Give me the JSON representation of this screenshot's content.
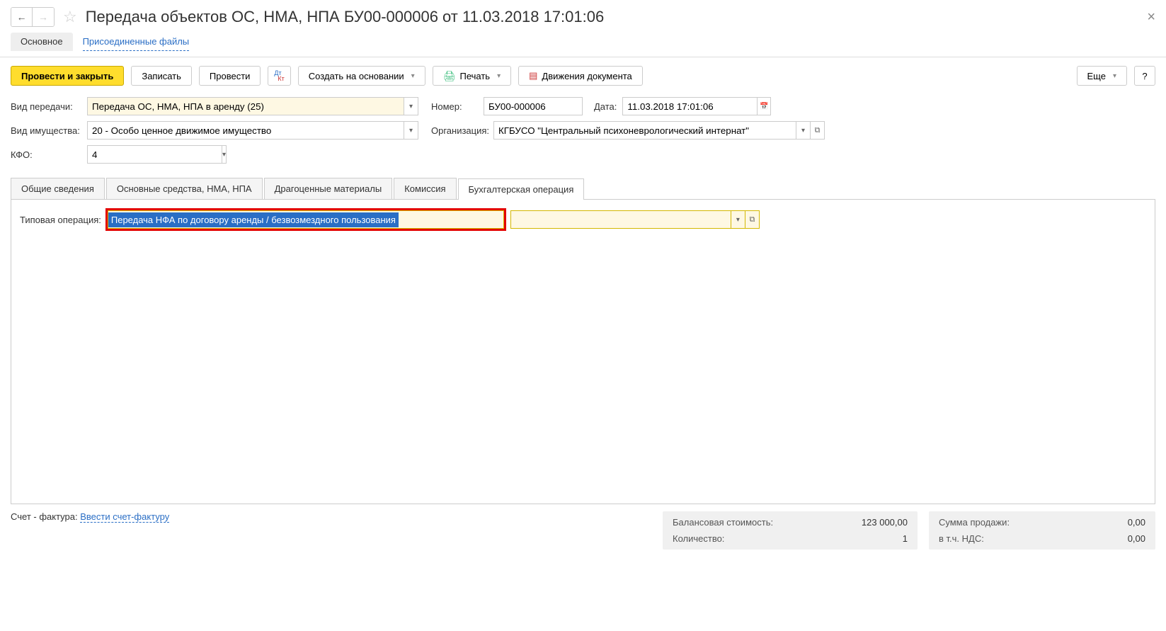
{
  "header": {
    "title": "Передача объектов ОС, НМА, НПА БУ00-000006 от 11.03.2018 17:01:06"
  },
  "subnav": {
    "main": "Основное",
    "attached": "Присоединенные файлы"
  },
  "toolbar": {
    "post_close": "Провести и закрыть",
    "save": "Записать",
    "post": "Провести",
    "create_based": "Создать на основании",
    "print": "Печать",
    "movements": "Движения документа",
    "more": "Еще",
    "help": "?"
  },
  "form": {
    "transfer_type": {
      "label": "Вид передачи:",
      "value": "Передача ОС, НМА, НПА в аренду (25)"
    },
    "number": {
      "label": "Номер:",
      "value": "БУ00-000006"
    },
    "date": {
      "label": "Дата:",
      "value": "11.03.2018 17:01:06"
    },
    "property_type": {
      "label": "Вид имущества:",
      "value": "20 - Особо ценное движимое имущество"
    },
    "organization": {
      "label": "Организация:",
      "value": "КГБУСО \"Центральный психоневрологический интернат\""
    },
    "kfo": {
      "label": "КФО:",
      "value": "4"
    }
  },
  "tabs": {
    "general": "Общие сведения",
    "fixed_assets": "Основные средства, НМА, НПА",
    "precious": "Драгоценные материалы",
    "commission": "Комиссия",
    "accounting": "Бухгалтерская операция"
  },
  "typical_op": {
    "label": "Типовая операция:",
    "value": "Передача НФА по договору аренды / безвозмездного пользования"
  },
  "footer": {
    "invoice_label": "Счет - фактура:",
    "invoice_link": "Ввести счет-фактуру",
    "balance_label": "Балансовая стоимость:",
    "balance_value": "123 000,00",
    "qty_label": "Количество:",
    "qty_value": "1",
    "sale_label": "Сумма продажи:",
    "sale_value": "0,00",
    "vat_label": "в т.ч. НДС:",
    "vat_value": "0,00"
  }
}
